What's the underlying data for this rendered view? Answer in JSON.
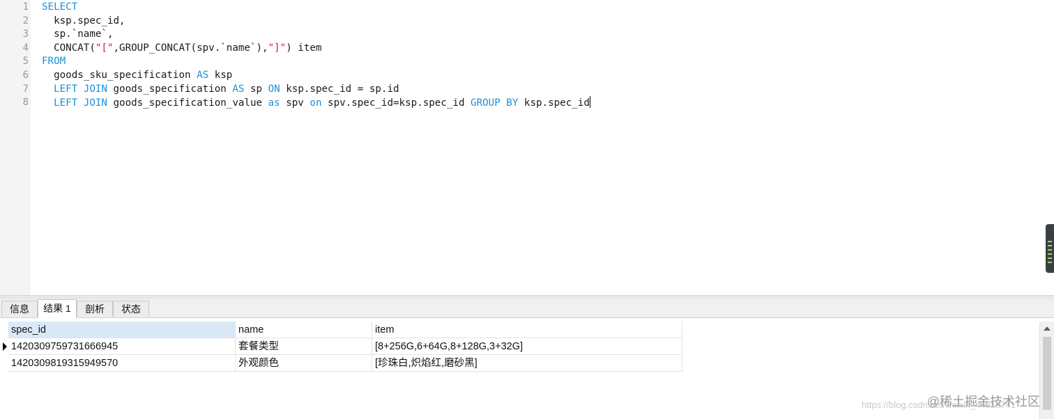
{
  "editor": {
    "line_numbers": [
      "1",
      "2",
      "3",
      "4",
      "5",
      "6",
      "7",
      "8"
    ],
    "lines": [
      [
        {
          "t": "kw",
          "v": "SELECT"
        }
      ],
      [
        {
          "t": "",
          "v": "  ksp.spec_id,"
        }
      ],
      [
        {
          "t": "",
          "v": "  sp.`name`,"
        }
      ],
      [
        {
          "t": "",
          "v": "  CONCAT("
        },
        {
          "t": "str",
          "v": "\"[\""
        },
        {
          "t": "",
          "v": ",GROUP_CONCAT(spv.`name`),"
        },
        {
          "t": "str",
          "v": "\"]\""
        },
        {
          "t": "",
          "v": ") item"
        }
      ],
      [
        {
          "t": "kw",
          "v": "FROM"
        }
      ],
      [
        {
          "t": "",
          "v": "  goods_sku_specification "
        },
        {
          "t": "kw",
          "v": "AS"
        },
        {
          "t": "",
          "v": " ksp"
        }
      ],
      [
        {
          "t": "",
          "v": "  "
        },
        {
          "t": "kw",
          "v": "LEFT JOIN"
        },
        {
          "t": "",
          "v": " goods_specification "
        },
        {
          "t": "kw",
          "v": "AS"
        },
        {
          "t": "",
          "v": " sp "
        },
        {
          "t": "kw",
          "v": "ON"
        },
        {
          "t": "",
          "v": " ksp.spec_id = sp.id"
        }
      ],
      [
        {
          "t": "",
          "v": "  "
        },
        {
          "t": "kw",
          "v": "LEFT JOIN"
        },
        {
          "t": "",
          "v": " goods_specification_value "
        },
        {
          "t": "kw",
          "v": "as"
        },
        {
          "t": "",
          "v": " spv "
        },
        {
          "t": "kw",
          "v": "on"
        },
        {
          "t": "",
          "v": " spv.spec_id=ksp.spec_id "
        },
        {
          "t": "kw",
          "v": "GROUP BY"
        },
        {
          "t": "",
          "v": " ksp.spec_id"
        }
      ]
    ]
  },
  "tabs": [
    {
      "label": "信息",
      "active": false
    },
    {
      "label": "结果 1",
      "active": true
    },
    {
      "label": "剖析",
      "active": false
    },
    {
      "label": "状态",
      "active": false
    }
  ],
  "grid": {
    "columns": [
      "spec_id",
      "name",
      "item"
    ],
    "rows": [
      [
        "1420309759731666945",
        "套餐类型",
        "[8+256G,6+64G,8+128G,3+32G]"
      ],
      [
        "1420309819315949570",
        "外观颜色",
        "[珍珠白,炽焰红,磨砂黑]"
      ]
    ]
  },
  "watermark": {
    "text": "@稀土掘金技术社区",
    "url_text": "https://blog.csdn.net/weixin_44315741"
  },
  "colors": {
    "keyword": "#1a8fd8",
    "string": "#d8193a",
    "selected_header": "#d9e9f8"
  }
}
